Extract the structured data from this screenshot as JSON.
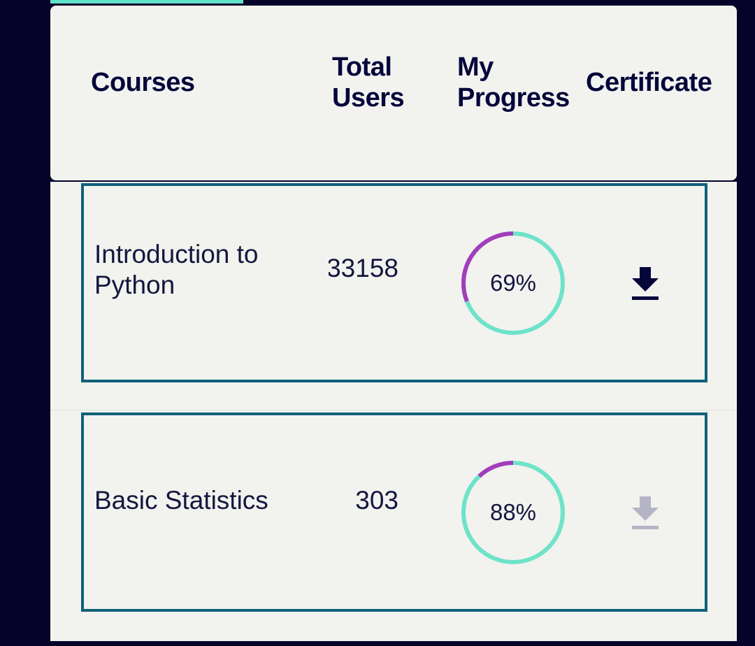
{
  "header": {
    "courses": "Courses",
    "total_users": "Total Users",
    "my_progress": "My Progress",
    "certificate": "Certificate"
  },
  "courses": [
    {
      "name": "Introduction to Python",
      "total_users": "33158",
      "progress": 69,
      "progress_label": "69%",
      "certificate_available": true,
      "certificate_icon": "download-icon"
    },
    {
      "name": "Basic Statistics",
      "total_users": "303",
      "progress": 88,
      "progress_label": "88%",
      "certificate_available": false,
      "certificate_icon": "download-icon"
    }
  ],
  "colors": {
    "background": "#05032a",
    "card": "#f2f2ef",
    "row_border": "#0f6179",
    "progress_complete": "#6ee3c9",
    "progress_remaining": "#a23dbb",
    "text": "#15163e",
    "icon_enabled": "#05063a",
    "icon_disabled": "#b4b4c6"
  }
}
